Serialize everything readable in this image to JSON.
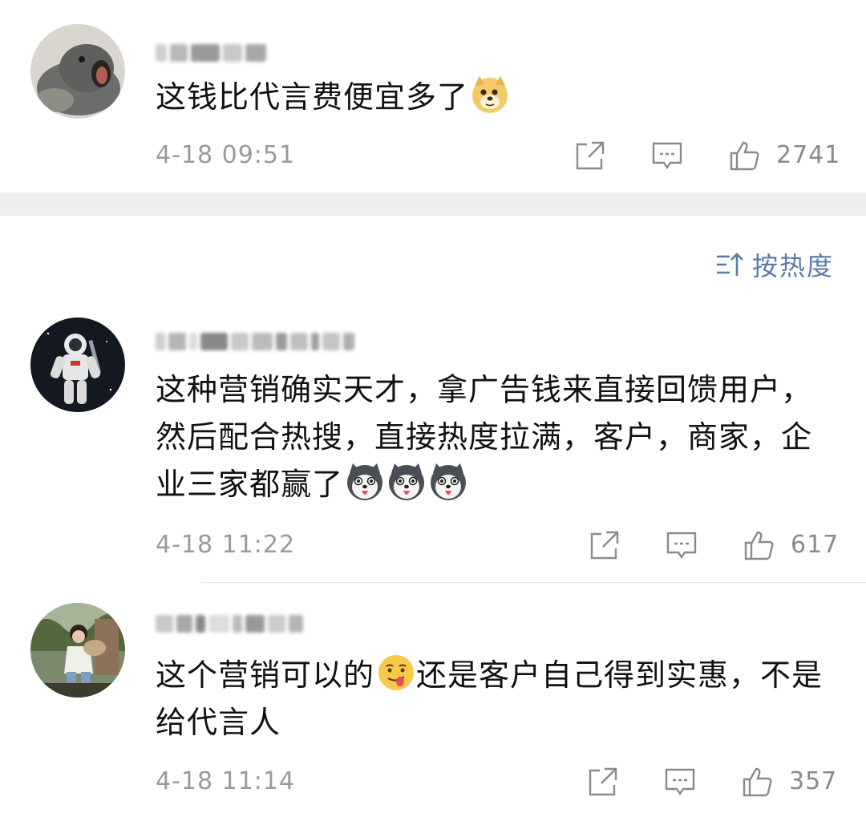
{
  "comments": [
    {
      "text": "这钱比代言费便宜多了",
      "emojis": [
        "doge-emoji"
      ],
      "time": "4-18 09:51",
      "likes": "2741"
    },
    {
      "text": "这种营销确实天才，拿广告钱来直接回馈用户，然后配合热搜，直接热度拉满，客户，商家，企业三家都赢了",
      "emojis": [
        "husky-emoji",
        "husky-emoji",
        "husky-emoji"
      ],
      "time": "4-18 11:22",
      "likes": "617"
    },
    {
      "text_part1": "这个营销可以的",
      "text_part2": "还是客户自己得到实惠，不是给代言人",
      "emojis": [
        "tongue-emoji"
      ],
      "time": "4-18 11:14",
      "likes": "357"
    }
  ],
  "sort": {
    "label": "按热度",
    "icon": "sort-icon"
  },
  "colors": {
    "separator": "#eeeeee",
    "sort_accent": "#5b7ca8",
    "meta_gray": "#9a9a9a"
  }
}
